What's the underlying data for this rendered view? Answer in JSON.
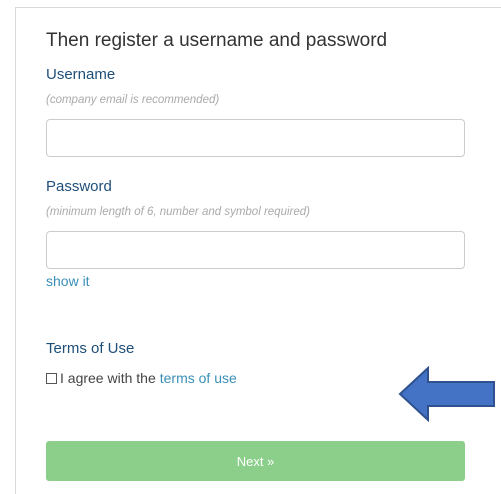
{
  "form": {
    "heading": "Then register a username and password",
    "username": {
      "label": "Username",
      "hint": "(company email is recommended)",
      "value": "",
      "placeholder": ""
    },
    "password": {
      "label": "Password",
      "hint": "(minimum length of 6, number and symbol required)",
      "value": "",
      "placeholder": ""
    },
    "show_link": "show it",
    "terms": {
      "heading": "Terms of Use",
      "agree_text": "I agree with the",
      "link_text": "terms of use",
      "checked": false
    },
    "next_label": "Next »"
  },
  "annotation": {
    "arrow_icon": "left-arrow-icon",
    "arrow_color": "#4472c4",
    "arrow_outline": "#2f528f"
  },
  "colors": {
    "label": "#1f4e79",
    "link": "#3a8fb7",
    "button": "#8ccf8b"
  }
}
